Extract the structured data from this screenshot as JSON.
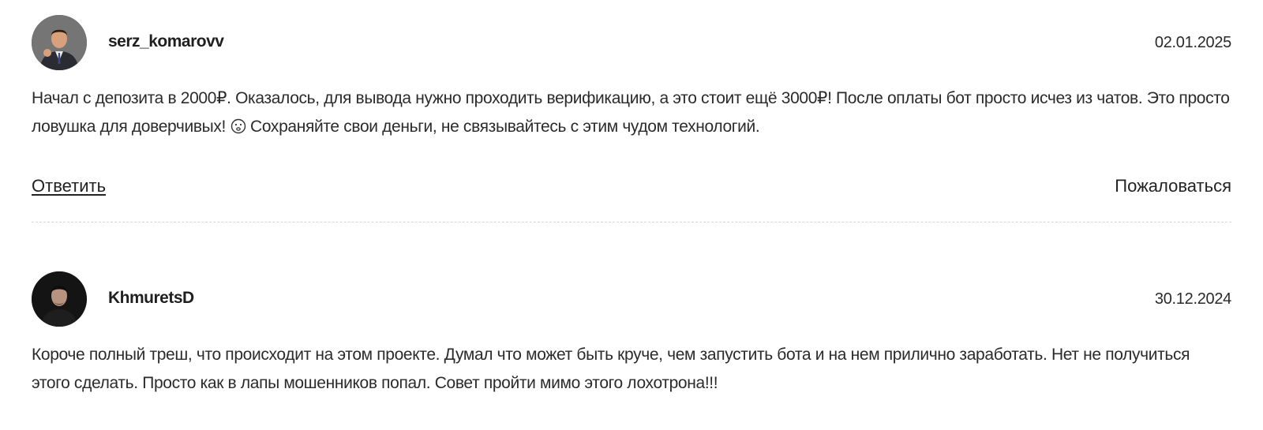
{
  "comments": [
    {
      "username": "serz_komarovv",
      "date": "02.01.2025",
      "text_before_emoji": "Начал с депозита в 2000₽. Оказалось, для вывода нужно проходить верификацию, а это стоит ещё 3000₽! После оплаты бот просто исчез из чатов. Это просто ловушка для доверчивых! ",
      "emoji": "neutral-face-icon",
      "text_after_emoji": " Сохраняйте свои деньги, не связывайтесь с этим чудом технологий.",
      "reply_label": "Ответить",
      "complain_label": "Пожаловаться"
    },
    {
      "username": "KhmuretsD",
      "date": "30.12.2024",
      "text": "Короче полный треш, что происходит на этом проекте. Думал что может быть круче, чем запустить бота и на нем прилично заработать. Нет не получиться этого сделать. Просто как в лапы мошенников попал. Совет пройти мимо этого лохотрона!!!"
    }
  ]
}
